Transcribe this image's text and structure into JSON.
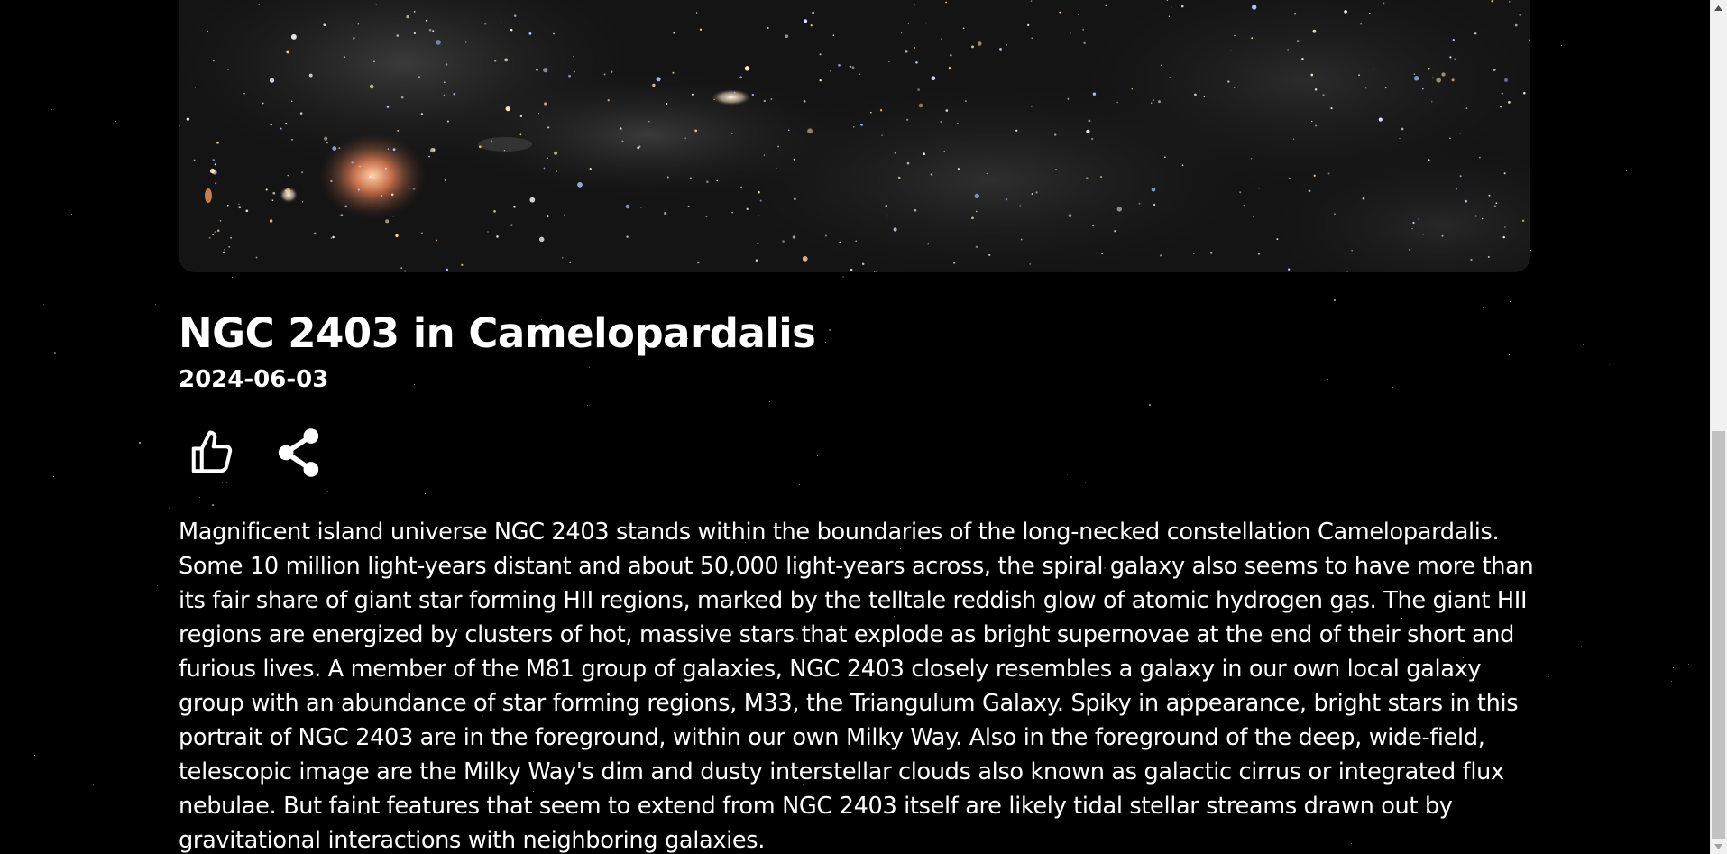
{
  "apod": {
    "title": "NGC 2403 in Camelopardalis",
    "date": "2024-06-03",
    "explanation": "Magnificent island universe NGC 2403 stands within the boundaries of the long-necked constellation Camelopardalis. Some 10 million light-years distant and about 50,000 light-years across, the spiral galaxy also seems to have more than its fair share of giant star forming HII regions, marked by the telltale reddish glow of atomic hydrogen gas. The giant HII regions are energized by clusters of hot, massive stars that explode as bright supernovae at the end of their short and furious lives. A member of the M81 group of galaxies, NGC 2403 closely resembles a galaxy in our own local galaxy group with an abundance of star forming regions, M33, the Triangulum Galaxy. Spiky in appearance, bright stars in this portrait of NGC 2403 are in the foreground, within our own Milky Way. Also in the foreground of the deep, wide-field, telescopic image are the Milky Way's dim and dusty interstellar clouds also known as galactic cirrus or integrated flux nebulae. But faint features that seem to extend from NGC 2403 itself are likely tidal stellar streams drawn out by gravitational interactions with neighboring galaxies."
  },
  "actions": {
    "like_icon": "thumbs-up-icon",
    "share_icon": "share-icon"
  },
  "colors": {
    "background": "#000000",
    "text": "#ffffff",
    "scrollbar_track": "#f1f1f1",
    "scrollbar_thumb": "#c1c1c1"
  }
}
